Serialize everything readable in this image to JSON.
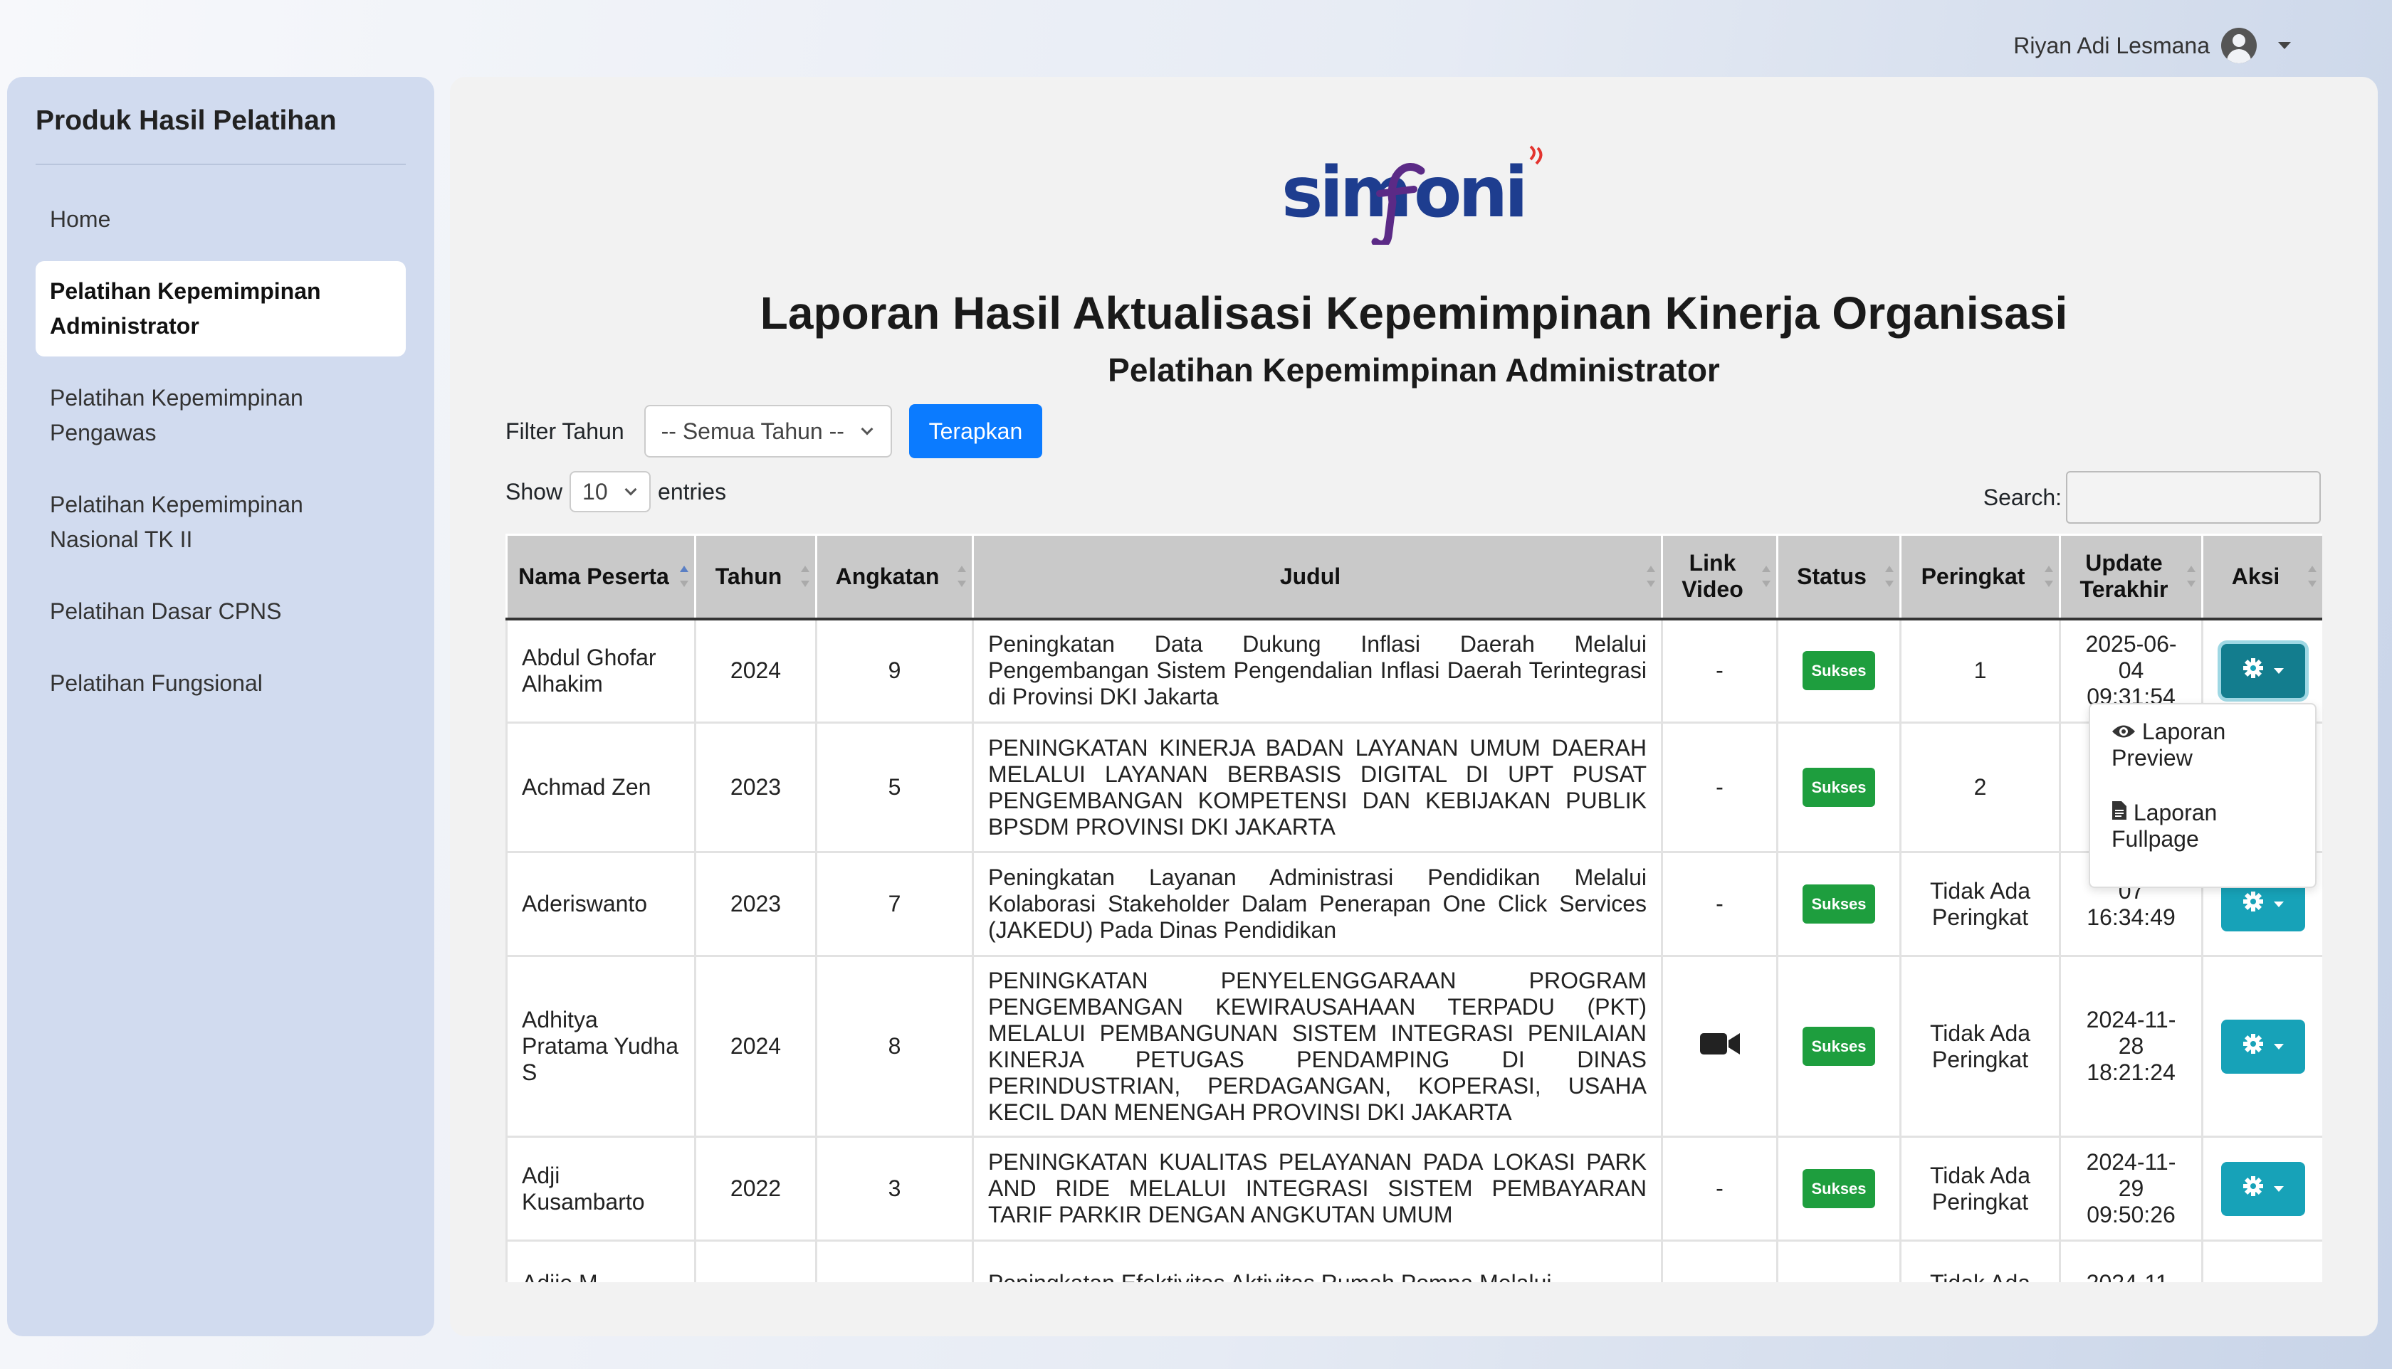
{
  "user": {
    "name": "Riyan Adi Lesmana"
  },
  "sidebar": {
    "title": "Produk Hasil Pelatihan",
    "items": [
      {
        "label": "Home"
      },
      {
        "label": "Pelatihan Kepemimpinan Administrator",
        "active": true
      },
      {
        "label": "Pelatihan Kepemimpinan Pengawas"
      },
      {
        "label": "Pelatihan Kepemimpinan Nasional TK II"
      },
      {
        "label": "Pelatihan Dasar CPNS"
      },
      {
        "label": "Pelatihan Fungsional"
      }
    ]
  },
  "logo": {
    "text": "simfoni"
  },
  "page": {
    "title": "Laporan Hasil Aktualisasi Kepemimpinan Kinerja Organisasi",
    "subtitle": "Pelatihan Kepemimpinan Administrator"
  },
  "filter": {
    "label": "Filter Tahun",
    "selected": "-- Semua Tahun --",
    "apply": "Terapkan"
  },
  "length": {
    "show": "Show",
    "value": "10",
    "entries": "entries"
  },
  "search": {
    "label": "Search:",
    "value": ""
  },
  "table": {
    "headers": [
      "Nama Peserta",
      "Tahun",
      "Angkatan",
      "Judul",
      "Link Video",
      "Status",
      "Peringkat",
      "Update Terakhir",
      "Aksi"
    ],
    "rows": [
      {
        "nama": "Abdul Ghofar Alhakim",
        "tahun": "2024",
        "angkatan": "9",
        "judul": "Peningkatan Data Dukung Inflasi Daerah Melalui Pengembangan Sistem Pengendalian Inflasi Daerah Terintegrasi di Provinsi DKI Jakarta",
        "video": "-",
        "status": "Sukses",
        "peringkat": "1",
        "update": "2025-06-04 09:31:54"
      },
      {
        "nama": "Achmad Zen",
        "tahun": "2023",
        "angkatan": "5",
        "judul": "PENINGKATAN KINERJA BADAN LAYANAN UMUM DAERAH MELALUI LAYANAN BERBASIS DIGITAL DI UPT PUSAT PENGEMBANGAN KOMPETENSI DAN KEBIJAKAN PUBLIK BPSDM PROVINSI DKI JAKARTA",
        "video": "-",
        "status": "Sukses",
        "peringkat": "2",
        "update": ""
      },
      {
        "nama": "Aderiswanto",
        "tahun": "2023",
        "angkatan": "7",
        "judul": "Peningkatan Layanan Administrasi Pendidikan Melalui Kolaborasi Stakeholder Dalam Penerapan One Click Services (JAKEDU) Pada Dinas Pendidikan",
        "video": "-",
        "status": "Sukses",
        "peringkat": "Tidak Ada Peringkat",
        "update": "07 16:34:49"
      },
      {
        "nama": "Adhitya Pratama Yudha S",
        "tahun": "2024",
        "angkatan": "8",
        "judul": "PENINGKATAN PENYELENGGARAAN PROGRAM PENGEMBANGAN KEWIRAUSAHAAN TERPADU (PKT) MELALUI PEMBANGUNAN SISTEM INTEGRASI PENILAIAN KINERJA PETUGAS PENDAMPING DI DINAS PERINDUSTRIAN, PERDAGANGAN, KOPERASI, USAHA KECIL DAN MENENGAH PROVINSI DKI JAKARTA",
        "video": "video-camera-icon",
        "status": "Sukses",
        "peringkat": "Tidak Ada Peringkat",
        "update": "2024-11-28 18:21:24"
      },
      {
        "nama": "Adji Kusambarto",
        "tahun": "2022",
        "angkatan": "3",
        "judul": "PENINGKATAN KUALITAS PELAYANAN PADA LOKASI PARK AND RIDE MELALUI INTEGRASI SISTEM PEMBAYARAN TARIF PARKIR DENGAN ANGKUTAN UMUM",
        "video": "-",
        "status": "Sukses",
        "peringkat": "Tidak Ada Peringkat",
        "update": "2024-11-29 09:50:26"
      },
      {
        "nama": "Adjie M...",
        "tahun": "",
        "angkatan": "",
        "judul": "Peningkatan Efektivitas Aktivitas Rumah Pompa Melalui",
        "video": "",
        "status": "",
        "peringkat": "Tidak Ada",
        "update": "2024-11-"
      }
    ]
  },
  "dropdown": {
    "items": [
      "Laporan Preview",
      "Laporan Fullpage"
    ]
  },
  "colors": {
    "primary": "#0b7bff",
    "info": "#17a2b8",
    "success": "#1e9e3e",
    "sidebar": "#d1dbef",
    "logo_blue": "#1e3d8f",
    "logo_purple": "#5b2a86",
    "logo_red": "#e3342f"
  }
}
